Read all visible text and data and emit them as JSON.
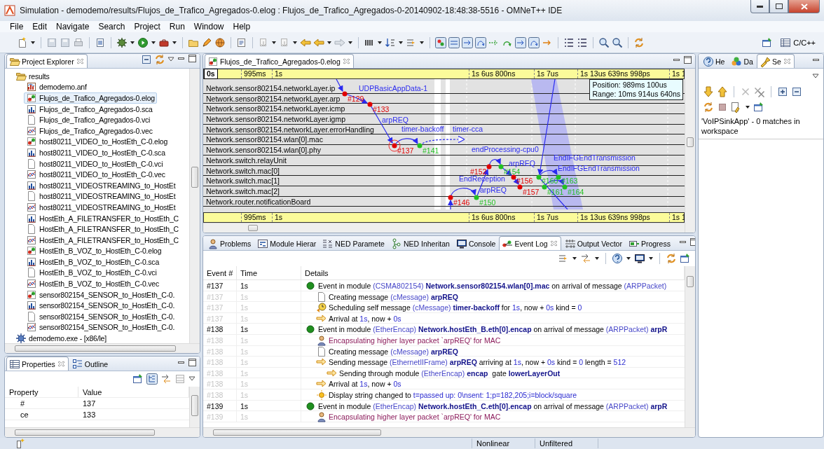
{
  "window": {
    "title": "Simulation - demodemo/results/Flujos_de_Trafico_Agregados-0.elog : Flujos_de_Trafico_Agregados-0-20140902-18:48:38-5516 - OMNeT++ IDE"
  },
  "menu": [
    "File",
    "Edit",
    "Navigate",
    "Search",
    "Project",
    "Run",
    "Window",
    "Help"
  ],
  "perspective": {
    "label": "C/C++"
  },
  "project_explorer": {
    "title": "Project Explorer",
    "tree": [
      {
        "label": "results",
        "kind": "folder",
        "expanded": true,
        "selected": false,
        "children": [
          {
            "label": "demodemo.anf",
            "kind": "anf",
            "selected": false
          },
          {
            "label": "Flujos_de_Trafico_Agregados-0.elog",
            "kind": "elog",
            "selected": true
          },
          {
            "label": "Flujos_de_Trafico_Agregados-0.sca",
            "kind": "sca",
            "selected": false
          },
          {
            "label": "Flujos_de_Trafico_Agregados-0.vci",
            "kind": "vci",
            "selected": false
          },
          {
            "label": "Flujos_de_Trafico_Agregados-0.vec",
            "kind": "vec",
            "selected": false
          },
          {
            "label": "host80211_VIDEO_to_HostEth_C-0.elog",
            "kind": "elog",
            "selected": false
          },
          {
            "label": "host80211_VIDEO_to_HostEth_C-0.sca",
            "kind": "sca",
            "selected": false
          },
          {
            "label": "host80211_VIDEO_to_HostEth_C-0.vci",
            "kind": "vci",
            "selected": false
          },
          {
            "label": "host80211_VIDEO_to_HostEth_C-0.vec",
            "kind": "vec",
            "selected": false
          },
          {
            "label": "host80211_VIDEOSTREAMING_to_HostEt",
            "kind": "sca",
            "selected": false
          },
          {
            "label": "host80211_VIDEOSTREAMING_to_HostEt",
            "kind": "vci",
            "selected": false
          },
          {
            "label": "host80211_VIDEOSTREAMING_to_HostEt",
            "kind": "vec",
            "selected": false
          },
          {
            "label": "HostEth_A_FILETRANSFER_to_HostEth_C",
            "kind": "sca",
            "selected": false
          },
          {
            "label": "HostEth_A_FILETRANSFER_to_HostEth_C",
            "kind": "vci",
            "selected": false
          },
          {
            "label": "HostEth_A_FILETRANSFER_to_HostEth_C",
            "kind": "vec",
            "selected": false
          },
          {
            "label": "HostEth_B_VOZ_to_HostEth_C-0.elog",
            "kind": "elog",
            "selected": false
          },
          {
            "label": "HostEth_B_VOZ_to_HostEth_C-0.sca",
            "kind": "sca",
            "selected": false
          },
          {
            "label": "HostEth_B_VOZ_to_HostEth_C-0.vci",
            "kind": "vci",
            "selected": false
          },
          {
            "label": "HostEth_B_VOZ_to_HostEth_C-0.vec",
            "kind": "vec",
            "selected": false
          },
          {
            "label": "sensor802154_SENSOR_to_HostEth_C-0.",
            "kind": "elog",
            "selected": false
          },
          {
            "label": "sensor802154_SENSOR_to_HostEth_C-0.",
            "kind": "sca",
            "selected": false
          },
          {
            "label": "sensor802154_SENSOR_to_HostEth_C-0.",
            "kind": "vci",
            "selected": false
          },
          {
            "label": "sensor802154_SENSOR_to_HostEth_C-0.",
            "kind": "vec",
            "selected": false
          }
        ]
      },
      {
        "label": "demodemo.exe - [x86/le]",
        "kind": "binary",
        "selected": false
      }
    ]
  },
  "properties": {
    "tabs": [
      {
        "label": "Properties",
        "selected": true
      },
      {
        "label": "Outline",
        "selected": false
      }
    ],
    "columns": [
      "Property",
      "Value"
    ],
    "rows": [
      [
        "#",
        "137"
      ],
      [
        "ce",
        "133"
      ]
    ]
  },
  "editor": {
    "tab": "Flujos_de_Trafico_Agregados-0.elog",
    "ruler": [
      {
        "label": "0s",
        "kind": "origin"
      },
      {
        "label": "995ms",
        "kind": "tick"
      },
      {
        "label": "1s",
        "kind": "tick"
      },
      {
        "label": "1s 6us 800ns",
        "kind": "tick"
      },
      {
        "label": "1s 7us",
        "kind": "tick"
      },
      {
        "label": "1s 13us 639ns 998ps",
        "kind": "tick"
      },
      {
        "label": "1s 1",
        "kind": "tick"
      }
    ],
    "bottom_ruler": [
      "995ms",
      "1s",
      "1s 6us 800ns",
      "1s 7us",
      "1s 13us 639ns 998ps",
      "1s 1"
    ],
    "tooltip": [
      "Position: 989ms 100us",
      "Range: 10ms 914us 640ns"
    ],
    "axes": [
      "Network.sensor802154.networkLayer.ip",
      "Network.sensor802154.networkLayer.arp",
      "Network.sensor802154.networkLayer.icmp",
      "Network.sensor802154.networkLayer.igmp",
      "Network.sensor802154.networkLayer.errorHandling",
      "Network.sensor802154.wlan[0].mac",
      "Network.sensor802154.wlan[0].phy",
      "Network.switch.relayUnit",
      "Network.switch.mac[0]",
      "Network.switch.mac[1]",
      "Network.switch.mac[2]",
      "Network.router.notificationBoard"
    ],
    "events": [
      {
        "number": "#129",
        "color": "#e00000"
      },
      {
        "number": "#133",
        "color": "#e00000"
      },
      {
        "number": "#137",
        "color": "#e00000"
      },
      {
        "number": "#141",
        "color": "#22c022"
      },
      {
        "number": "#146",
        "color": "#e00000"
      },
      {
        "number": "#150",
        "color": "#22c022"
      },
      {
        "number": "#152",
        "color": "#e00000"
      },
      {
        "number": "#154",
        "color": "#22c022"
      },
      {
        "number": "#156",
        "color": "#e00000"
      },
      {
        "number": "#157",
        "color": "#e00000"
      },
      {
        "number": "#160",
        "color": "#22c022"
      },
      {
        "number": "#161",
        "color": "#22c022"
      },
      {
        "number": "#163",
        "color": "#22c022"
      },
      {
        "number": "#164",
        "color": "#22c022"
      }
    ],
    "messages": [
      "UDPBasicAppData-1",
      "arpREQ",
      "timer-backoff",
      "timer-cca",
      "endProcessing-cpu0",
      "arpREQ",
      "EndIFGEndTransmission",
      "EndIFGEndTransmission",
      "EndReception",
      "arpREQ"
    ]
  },
  "views": {
    "tabs": [
      {
        "label": "Problems",
        "selected": false
      },
      {
        "label": "Module Hierar",
        "selected": false
      },
      {
        "label": "NED Paramete",
        "selected": false
      },
      {
        "label": "NED Inheritan",
        "selected": false
      },
      {
        "label": "Console",
        "selected": false
      },
      {
        "label": "Event Log",
        "selected": true
      },
      {
        "label": "Output Vector",
        "selected": false
      },
      {
        "label": "Progress",
        "selected": false
      }
    ],
    "columns": [
      "Event #",
      "Time",
      "Details"
    ],
    "events": [
      {
        "number": "#137",
        "time": "1s",
        "details": [
          {
            "text": "Event in module "
          },
          {
            "text": "(CSMA802154) ",
            "kind": "type"
          },
          {
            "text": "Network.sensor802154.wlan[0].mac",
            "kind": "name"
          },
          {
            "text": " on arrival of message "
          },
          {
            "text": "(ARPPacket)",
            "kind": "type"
          }
        ],
        "entries": [
          {
            "kind": "create",
            "number": "#137",
            "time": "1s",
            "details": [
              {
                "text": "Creating message "
              },
              {
                "text": "(cMessage) ",
                "kind": "type"
              },
              {
                "text": "arpREQ",
                "kind": "name"
              }
            ]
          },
          {
            "kind": "schedule",
            "number": "#137",
            "time": "1s",
            "details": [
              {
                "text": "Scheduling self message "
              },
              {
                "text": "(cMessage) ",
                "kind": "type"
              },
              {
                "text": "timer-backoff",
                "kind": "name"
              },
              {
                "text": " for "
              },
              {
                "text": "1s",
                "kind": "value"
              },
              {
                "text": ", now + "
              },
              {
                "text": "0s",
                "kind": "value"
              },
              {
                "text": " kind = "
              },
              {
                "text": "0",
                "kind": "value"
              }
            ]
          },
          {
            "kind": "arrival",
            "number": "#137",
            "time": "1s",
            "details": [
              {
                "text": "Arrival at "
              },
              {
                "text": "1s",
                "kind": "value"
              },
              {
                "text": ", now + "
              },
              {
                "text": "0s",
                "kind": "value"
              }
            ]
          }
        ]
      },
      {
        "number": "#138",
        "time": "1s",
        "details": [
          {
            "text": "Event in module "
          },
          {
            "text": "(EtherEncap) ",
            "kind": "type"
          },
          {
            "text": "Network.hostEth_B.eth[0].encap",
            "kind": "name"
          },
          {
            "text": " on arrival of message "
          },
          {
            "text": "(ARPPacket) ",
            "kind": "type"
          },
          {
            "text": "arpR",
            "kind": "name"
          }
        ],
        "entries": [
          {
            "kind": "encapsulate",
            "number": "#138",
            "time": "1s",
            "details": [
              {
                "text": "Encapsulating higher layer packet `arpREQ' for MAC"
              }
            ]
          },
          {
            "kind": "create",
            "number": "#138",
            "time": "1s",
            "details": [
              {
                "text": "Creating message "
              },
              {
                "text": "(cMessage) ",
                "kind": "type"
              },
              {
                "text": "arpREQ",
                "kind": "name"
              }
            ]
          },
          {
            "kind": "send",
            "number": "#138",
            "time": "1s",
            "details": [
              {
                "text": "Sending message "
              },
              {
                "text": "(EthernetIIFrame) ",
                "kind": "type"
              },
              {
                "text": "arpREQ",
                "kind": "name"
              },
              {
                "text": " arriving at "
              },
              {
                "text": "1s",
                "kind": "value"
              },
              {
                "text": ", now + "
              },
              {
                "text": "0s",
                "kind": "value"
              },
              {
                "text": " kind = "
              },
              {
                "text": "0",
                "kind": "value"
              },
              {
                "text": " length = "
              },
              {
                "text": "512",
                "kind": "value"
              }
            ],
            "children": [
              {
                "kind": "send",
                "number": "#138",
                "time": "1s",
                "details": [
                  {
                    "text": "Sending through module "
                  },
                  {
                    "text": "(EtherEncap) ",
                    "kind": "type"
                  },
                  {
                    "text": "encap",
                    "kind": "name"
                  },
                  {
                    "text": "  gate "
                  },
                  {
                    "text": "lowerLayerOut",
                    "kind": "name"
                  }
                ]
              }
            ]
          },
          {
            "kind": "arrival",
            "number": "#138",
            "time": "1s",
            "details": [
              {
                "text": "Arrival at "
              },
              {
                "text": "1s",
                "kind": "value"
              },
              {
                "text": ", now + "
              },
              {
                "text": "0s",
                "kind": "value"
              }
            ]
          },
          {
            "kind": "display",
            "number": "#138",
            "time": "1s",
            "details": [
              {
                "text": "Display string changed to "
              },
              {
                "text": "t=passed up: 0\\nsent: 1;p=182,205;i=block/square",
                "kind": "value"
              }
            ]
          }
        ]
      },
      {
        "number": "#139",
        "time": "1s",
        "details": [
          {
            "text": "Event in module "
          },
          {
            "text": "(EtherEncap) ",
            "kind": "type"
          },
          {
            "text": "Network.hostEth_C.eth[0].encap",
            "kind": "name"
          },
          {
            "text": " on arrival of message "
          },
          {
            "text": "(ARPPacket) ",
            "kind": "type"
          },
          {
            "text": "arpR",
            "kind": "name"
          }
        ],
        "entries": [
          {
            "kind": "encapsulate",
            "number": "#139",
            "time": "1s",
            "details": [
              {
                "text": "Encapsulating higher layer packet `arpREQ' for MAC"
              }
            ]
          }
        ]
      }
    ]
  },
  "search_view": {
    "tabs": [
      {
        "label": "He",
        "selected": false
      },
      {
        "label": "Da",
        "selected": false
      },
      {
        "label": "Se",
        "selected": true
      }
    ],
    "result": "'VoIPSinkApp' - 0 matches in workspace"
  },
  "status_bar": [
    "Nonlinear",
    "Unfiltered"
  ]
}
